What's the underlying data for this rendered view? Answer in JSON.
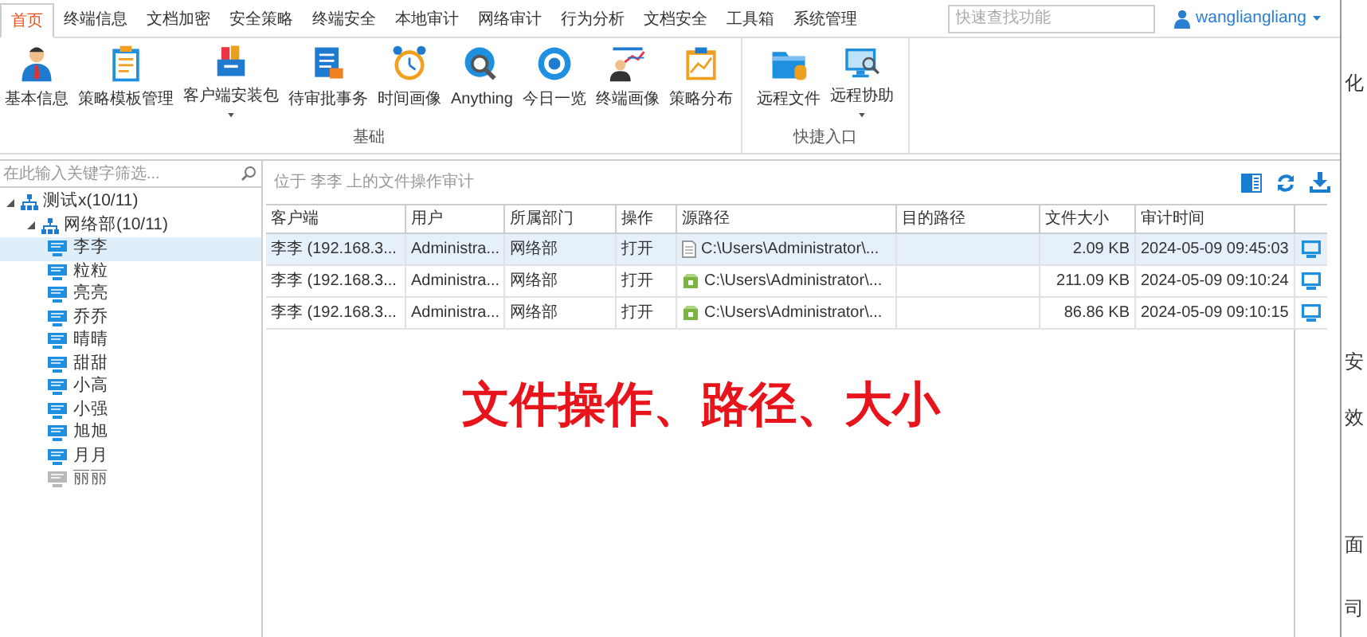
{
  "tabs": [
    {
      "label": "首页",
      "selected": true
    },
    {
      "label": "终端信息",
      "selected": false
    },
    {
      "label": "文档加密",
      "selected": false
    },
    {
      "label": "安全策略",
      "selected": false
    },
    {
      "label": "终端安全",
      "selected": false
    },
    {
      "label": "本地审计",
      "selected": false
    },
    {
      "label": "网络审计",
      "selected": false
    },
    {
      "label": "行为分析",
      "selected": false
    },
    {
      "label": "文档安全",
      "selected": false
    },
    {
      "label": "工具箱",
      "selected": false
    },
    {
      "label": "系统管理",
      "selected": false
    }
  ],
  "quick_search": {
    "placeholder": "快速查找功能"
  },
  "user": {
    "name": "wangliangliang"
  },
  "ribbon_groups": [
    {
      "label": "基础",
      "buttons": [
        {
          "label": "基本信息",
          "dropdown": false
        },
        {
          "label": "策略模板管理",
          "dropdown": false
        },
        {
          "label": "客户端安装包",
          "dropdown": true
        },
        {
          "label": "待审批事务",
          "dropdown": false
        },
        {
          "label": "时间画像",
          "dropdown": false
        },
        {
          "label": "Anything",
          "dropdown": false
        },
        {
          "label": "今日一览",
          "dropdown": false
        },
        {
          "label": "终端画像",
          "dropdown": false
        },
        {
          "label": "策略分布",
          "dropdown": false
        }
      ]
    },
    {
      "label": "快捷入口",
      "buttons": [
        {
          "label": "远程文件",
          "dropdown": false
        },
        {
          "label": "远程协助",
          "dropdown": true
        }
      ]
    }
  ],
  "sidebar": {
    "filter": {
      "placeholder": "在此输入关键字筛选..."
    },
    "tree": [
      {
        "label": "测试x(10/11)",
        "expanded": true,
        "children": [
          {
            "label": "网络部(10/11)",
            "expanded": true,
            "children": [
              {
                "label": "李李",
                "online": true,
                "selected": true
              },
              {
                "label": "粒粒",
                "online": true,
                "selected": false
              },
              {
                "label": "亮亮",
                "online": true,
                "selected": false
              },
              {
                "label": "乔乔",
                "online": true,
                "selected": false
              },
              {
                "label": "晴晴",
                "online": true,
                "selected": false
              },
              {
                "label": "甜甜",
                "online": true,
                "selected": false
              },
              {
                "label": "小高",
                "online": true,
                "selected": false
              },
              {
                "label": "小强",
                "online": true,
                "selected": false
              },
              {
                "label": "旭旭",
                "online": true,
                "selected": false
              },
              {
                "label": "月月",
                "online": true,
                "selected": false
              },
              {
                "label": "丽丽",
                "online": false,
                "selected": false
              }
            ]
          }
        ]
      }
    ]
  },
  "panel": {
    "title": "位于 李李 上的文件操作审计"
  },
  "table": {
    "columns": [
      "客户端",
      "用户",
      "所属部门",
      "操作",
      "源路径",
      "目的路径",
      "文件大小",
      "审计时间"
    ],
    "rows": [
      {
        "selected": true,
        "client": "李李 (192.168.3...",
        "user": "Administra...",
        "department": "网络部",
        "operation": "打开",
        "kind": "text",
        "source": "C:\\Users\\Administrator\\...",
        "size": "2.09 KB",
        "time": "2024-05-09 09:45:03"
      },
      {
        "selected": false,
        "client": "李李 (192.168.3...",
        "user": "Administra...",
        "department": "网络部",
        "operation": "打开",
        "kind": "archive",
        "source": "C:\\Users\\Administrator\\...",
        "size": "211.09 KB",
        "time": "2024-05-09 09:10:24"
      },
      {
        "selected": false,
        "client": "李李 (192.168.3...",
        "user": "Administra...",
        "department": "网络部",
        "operation": "打开",
        "kind": "archive",
        "source": "C:\\Users\\Administrator\\...",
        "size": "86.86 KB",
        "time": "2024-05-09 09:10:15"
      }
    ]
  },
  "caption": "文件操作、路径、大小",
  "background_fragments": [
    "化",
    "安",
    "效",
    "面",
    "司"
  ]
}
